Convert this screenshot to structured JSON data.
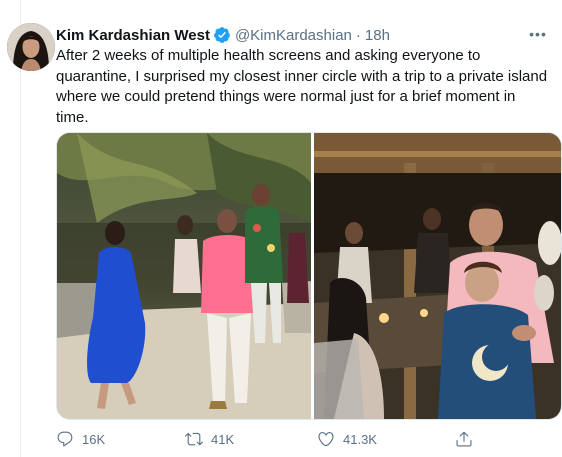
{
  "tweet": {
    "author_name": "Kim Kardashian West",
    "handle": "@KimKardashian",
    "separator": "·",
    "time": "18h",
    "more_label": "•••",
    "text": "After 2 weeks of multiple health screens and asking everyone to\nquarantine, I surprised my closest inner circle with a trip to a private island\nwhere we could pretend things were normal just for a brief moment in\ntime.",
    "verified": true
  },
  "actions": {
    "reply_count": "16K",
    "retweet_count": "41K",
    "like_count": "41.3K"
  },
  "media": {
    "photos": [
      "beach-night-group-walking",
      "dinner-party-father-and-son"
    ]
  },
  "icons": [
    "verified-badge-icon",
    "more-icon",
    "reply-icon",
    "retweet-icon",
    "like-icon",
    "share-icon"
  ],
  "colors": {
    "accent": "#1da1f2",
    "secondary_text": "#5b7083",
    "primary_text": "#0f1419",
    "border": "#e1e8ed"
  }
}
